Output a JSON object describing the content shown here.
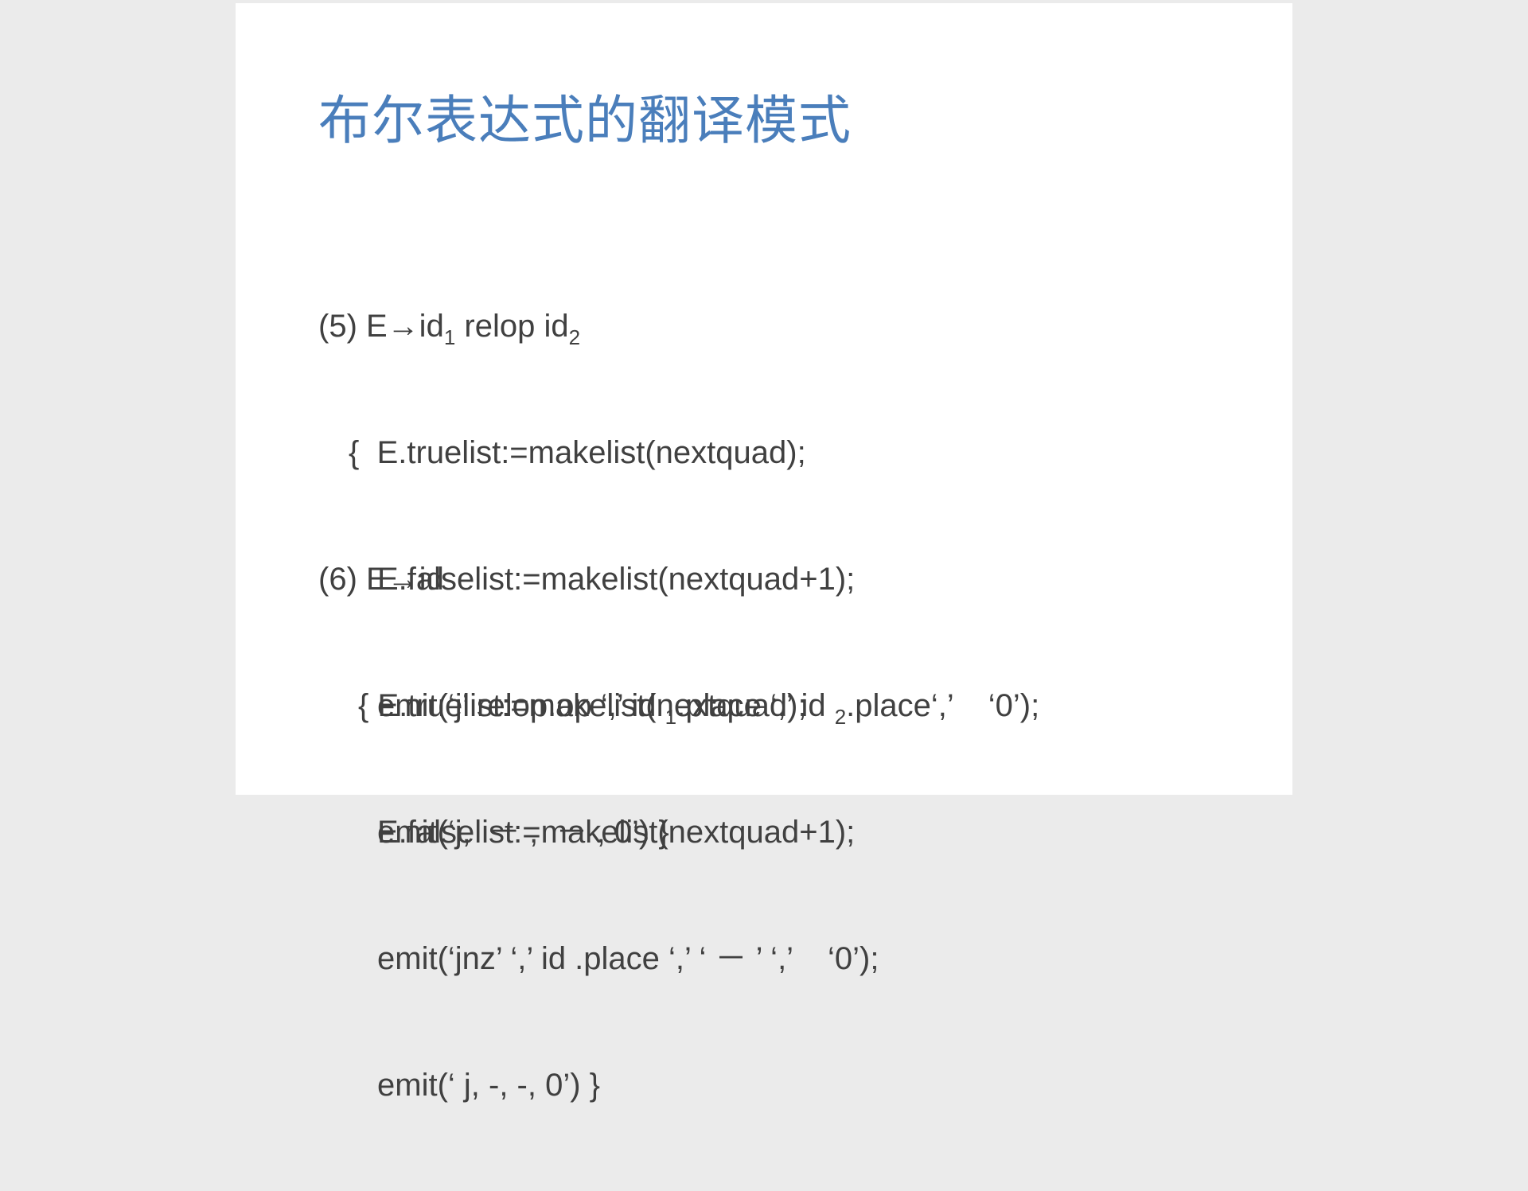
{
  "slide": {
    "title": "布尔表达式的翻译模式",
    "rule5": {
      "head_prefix": "(5) E→id",
      "head_sub1": "1",
      "head_mid": " relop id",
      "head_sub2": "2",
      "line1": "{  E.truelist:=makelist(nextquad);",
      "line2": "E.falselist:=makelist(nextquad+1);",
      "line3_a": "emit(‘j’ relop.op ‘,’ id ",
      "line3_sub1": "1",
      "line3_b": ".place ‘,’ id ",
      "line3_sub2": "2",
      "line3_c": ".place‘,’    ‘0’);",
      "line4": "emit(‘j,  － ,  － , 0’) }"
    },
    "rule6": {
      "head": "(6) E→id",
      "line1": "{ E.truelist:=makelist(nextquad);",
      "line2": "E.falselist:=makelist(nextquad+1);",
      "line3": "emit(‘jnz’ ‘,’ id .place ‘,’ ‘ － ’ ‘,’    ‘0’);",
      "line4": "emit(‘ j, -, -, 0’) }"
    }
  }
}
